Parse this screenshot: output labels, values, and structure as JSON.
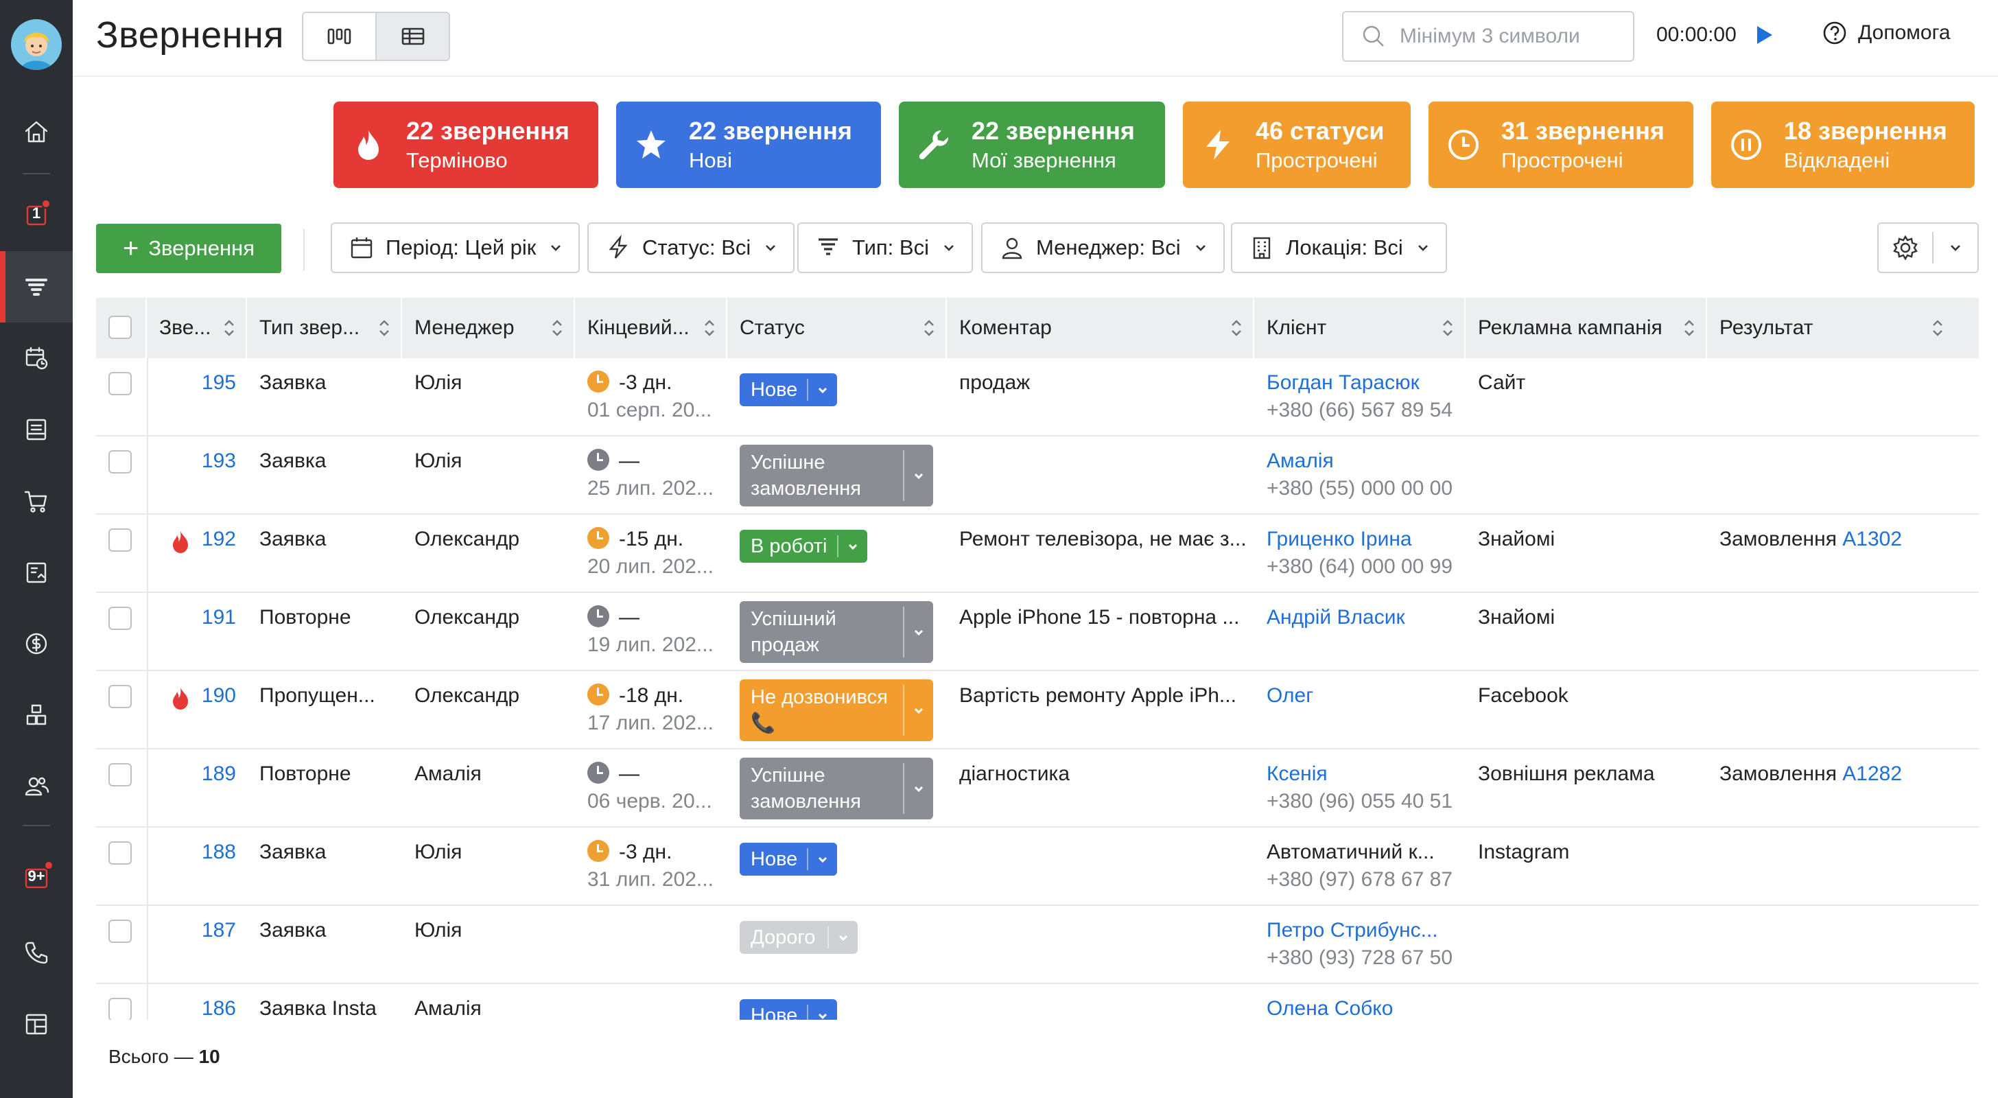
{
  "header": {
    "title": "Звернення",
    "search_placeholder": "Мінімум 3 символи",
    "timer": "00:00:00",
    "help_label": "Допомога"
  },
  "sidebar": {
    "badge_calendar": "1",
    "badge_notifications": "9+"
  },
  "cards": [
    {
      "title": "22 звернення",
      "subtitle": "Терміново",
      "color": "#e53935",
      "icon": "fire-icon"
    },
    {
      "title": "22 звернення",
      "subtitle": "Нові",
      "color": "#3a73e0",
      "icon": "star-icon"
    },
    {
      "title": "22 звернення",
      "subtitle": "Мої звернення",
      "color": "#43a047",
      "icon": "wrench-icon"
    },
    {
      "title": "46 статуси",
      "subtitle": "Прострочені",
      "color": "#f29d2e",
      "icon": "lightning-icon"
    },
    {
      "title": "31 звернення",
      "subtitle": "Прострочені",
      "color": "#f29d2e",
      "icon": "clock-icon"
    },
    {
      "title": "18 звернення",
      "subtitle": "Відкладені",
      "color": "#f29d2e",
      "icon": "pause-icon"
    }
  ],
  "toolbar": {
    "add_label": "Звернення",
    "filters": [
      "Період: Цей рік",
      "Статус: Всі",
      "Тип: Всі",
      "Менеджер: Всі",
      "Локація: Всі"
    ]
  },
  "table": {
    "columns": [
      "Зве...",
      "Тип звер...",
      "Менеджер",
      "Кінцевий...",
      "Статус",
      "Коментар",
      "Клієнт",
      "Рекламна кампанія",
      "Результат"
    ],
    "rows": [
      {
        "id": "195",
        "urgent": false,
        "type": "Заявка",
        "manager": "Юлія",
        "clock": "orange",
        "due": "-3 дн.",
        "date": "01 серп. 20...",
        "status": "Нове",
        "status_color": "#3a73e0",
        "comment": "продаж",
        "client": "Богдан Тарасюк",
        "client_link": true,
        "phone": "+380 (66) 567 89 54",
        "campaign": "Сайт",
        "result": "",
        "result_link": ""
      },
      {
        "id": "193",
        "urgent": false,
        "type": "Заявка",
        "manager": "Юлія",
        "clock": "gray",
        "due": "—",
        "date": "25 лип. 202...",
        "status": "Успішне замовлення",
        "status_color": "#8a8e94",
        "comment": "",
        "client": "Амалія",
        "client_link": true,
        "phone": "+380 (55) 000 00 00",
        "campaign": "",
        "result": "",
        "result_link": ""
      },
      {
        "id": "192",
        "urgent": true,
        "type": "Заявка",
        "manager": "Олександр",
        "clock": "orange",
        "due": "-15 дн.",
        "date": "20 лип. 202...",
        "status": "В роботі",
        "status_color": "#43a047",
        "comment": "Ремонт телевізора, не має з...",
        "client": "Гриценко Ірина",
        "client_link": true,
        "phone": "+380 (64) 000 00 99",
        "campaign": "Знайомі",
        "result": "Замовлення",
        "result_link": "А1302"
      },
      {
        "id": "191",
        "urgent": false,
        "type": "Повторне",
        "manager": "Олександр",
        "clock": "gray",
        "due": "—",
        "date": "19 лип. 202...",
        "status": "Успішний продаж",
        "status_color": "#8a8e94",
        "comment": "Apple iPhone 15 - повторна ...",
        "client": "Андрій Власик",
        "client_link": true,
        "phone": "",
        "campaign": "Знайомі",
        "result": "",
        "result_link": ""
      },
      {
        "id": "190",
        "urgent": true,
        "type": "Пропущен...",
        "manager": "Олександр",
        "clock": "orange",
        "due": "-18 дн.",
        "date": "17 лип. 202...",
        "status": "Не дозвонився 📞",
        "status_color": "#f29d2e",
        "comment": "Вартість ремонту Apple iPh...",
        "client": "Олег",
        "client_link": true,
        "phone": "",
        "campaign": "Facebook",
        "result": "",
        "result_link": ""
      },
      {
        "id": "189",
        "urgent": false,
        "type": "Повторне",
        "manager": "Амалія",
        "clock": "gray",
        "due": "—",
        "date": "06 черв. 20...",
        "status": "Успішне замовлення",
        "status_color": "#8a8e94",
        "comment": "діагностика",
        "client": "Ксенія",
        "client_link": true,
        "phone": "+380 (96) 055 40 51",
        "campaign": "Зовнішня реклама",
        "result": "Замовлення",
        "result_link": "А1282"
      },
      {
        "id": "188",
        "urgent": false,
        "type": "Заявка",
        "manager": "Юлія",
        "clock": "orange",
        "due": "-3 дн.",
        "date": "31 лип. 202...",
        "status": "Нове",
        "status_color": "#3a73e0",
        "comment": "",
        "client": "Автоматичний к...",
        "client_link": false,
        "phone": "+380 (97) 678 67 87",
        "campaign": "Instagram",
        "result": "",
        "result_link": ""
      },
      {
        "id": "187",
        "urgent": false,
        "type": "Заявка",
        "manager": "Юлія",
        "clock": "",
        "due": "",
        "date": "",
        "status": "Дорого",
        "status_color": "#cfd1d4",
        "comment": "",
        "client": "Петро Стрибунс...",
        "client_link": true,
        "phone": "+380 (93) 728 67 50",
        "campaign": "",
        "result": "",
        "result_link": ""
      },
      {
        "id": "186",
        "urgent": false,
        "type": "Заявка Insta",
        "manager": "Амалія",
        "clock": "",
        "due": "",
        "date": "",
        "status": "Нове",
        "status_color": "#3a73e0",
        "comment": "",
        "client": "Олена Собко",
        "client_link": true,
        "phone": "",
        "campaign": "",
        "result": "",
        "result_link": ""
      }
    ]
  },
  "footer": {
    "label": "Всього — ",
    "count": "10"
  }
}
